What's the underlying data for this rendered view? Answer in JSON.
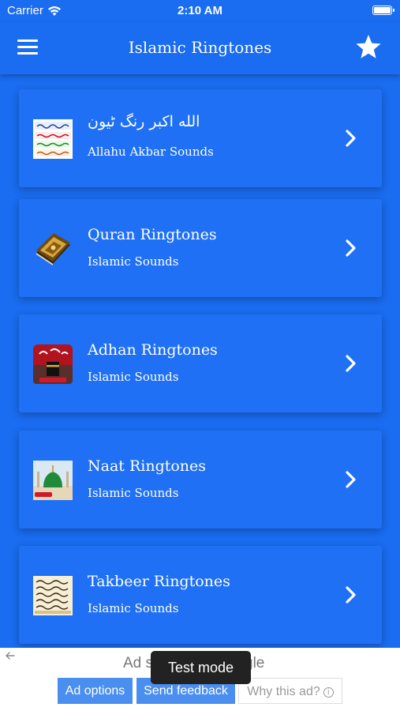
{
  "status_bar": {
    "carrier": "Carrier",
    "time": "2:10 AM",
    "battery_level": 1.0,
    "wifi_icon": "wifi-icon",
    "battery_icon": "battery-icon"
  },
  "app_bar": {
    "title": "Islamic Ringtones",
    "menu_icon": "hamburger-menu-icon",
    "star_icon": "star-icon"
  },
  "cards": [
    {
      "title": "الله اکبر رنگ ٹیون",
      "subtitle": "Allahu Akbar Sounds",
      "thumb_icon": "allahu-akbar-calligraphy-thumbnail"
    },
    {
      "title": "Quran Ringtones",
      "subtitle": "Islamic Sounds",
      "thumb_icon": "quran-book-thumbnail"
    },
    {
      "title": "Adhan Ringtones",
      "subtitle": "Islamic Sounds",
      "thumb_icon": "kaaba-adhan-thumbnail"
    },
    {
      "title": "Naat Ringtones",
      "subtitle": "Islamic Sounds",
      "thumb_icon": "green-dome-thumbnail"
    },
    {
      "title": "Takbeer Ringtones",
      "subtitle": "Islamic Sounds",
      "thumb_icon": "takbeer-calligraphy-thumbnail"
    }
  ],
  "ad": {
    "label_left": "Ad s",
    "label_right": "gle",
    "test_mode": "Test mode",
    "ad_options": "Ad options",
    "send_feedback": "Send feedback",
    "why_this_ad": "Why this ad?",
    "info_glyph": "i"
  },
  "colors": {
    "primary": "#1a6cf0",
    "card": "#1f70f4",
    "ad_button": "#4a8ef0"
  }
}
